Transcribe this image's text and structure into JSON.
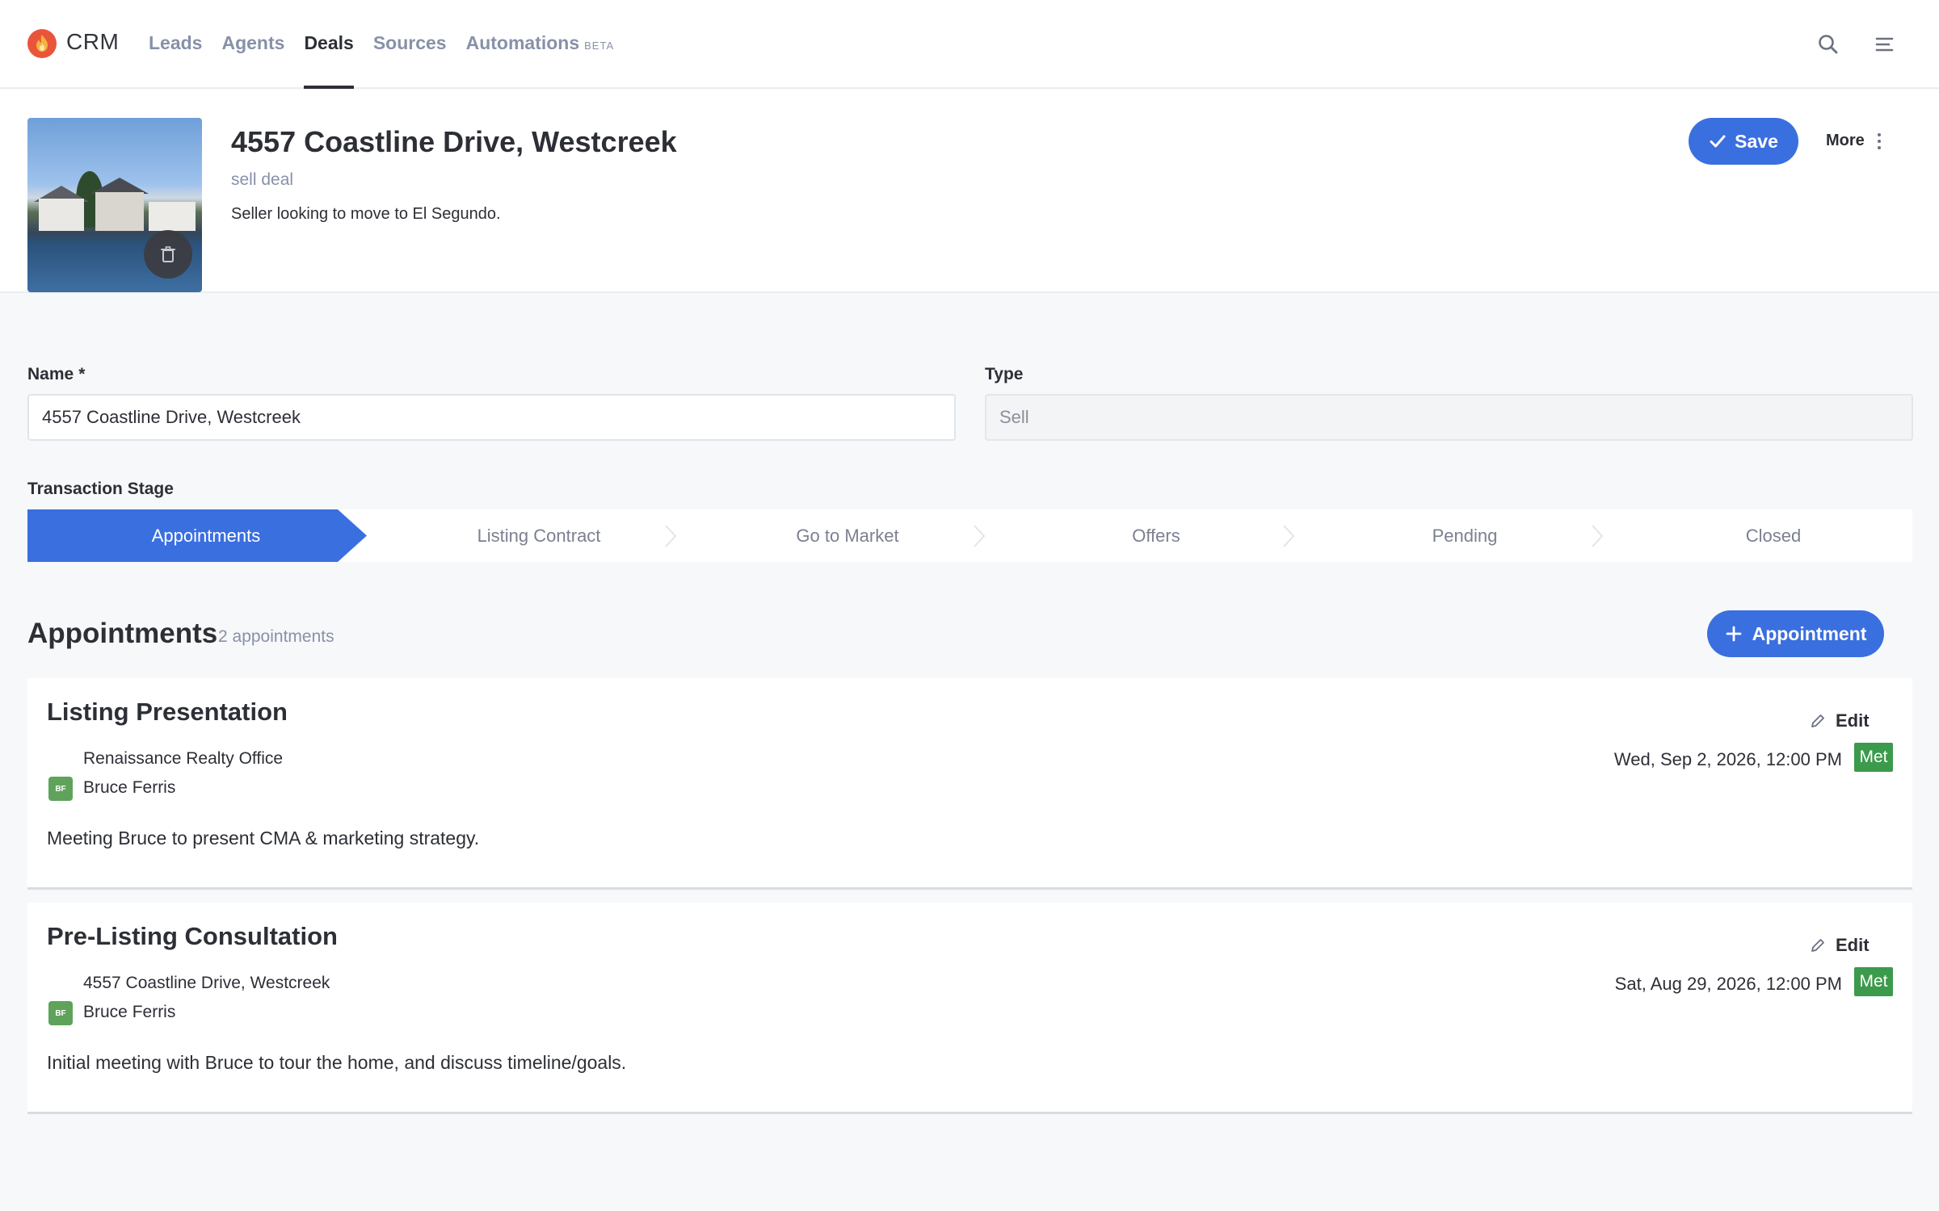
{
  "app": {
    "brand": "CRM",
    "nav": [
      {
        "label": "Leads"
      },
      {
        "label": "Agents"
      },
      {
        "label": "Deals"
      },
      {
        "label": "Sources"
      },
      {
        "label": "Automations"
      }
    ],
    "active_nav": "Deals",
    "beta_label": "BETA"
  },
  "deal": {
    "title": "4557 Coastline Drive, Westcreek",
    "subtitle": "sell deal",
    "description": "Seller looking to move to El Segundo.",
    "save_label": "Save",
    "more_label": "More"
  },
  "form": {
    "name_label": "Name",
    "name_required": "*",
    "name_value": "4557 Coastline Drive, Westcreek",
    "type_label": "Type",
    "type_value": "Sell",
    "stage_label": "Transaction Stage"
  },
  "stages": [
    "Appointments",
    "Listing Contract",
    "Go to Market",
    "Offers",
    "Pending",
    "Closed"
  ],
  "active_stage": "Appointments",
  "appointments": {
    "heading": "Appointments",
    "count_label": "2 appointments",
    "add_label": "Appointment",
    "edit_label": "Edit",
    "items": [
      {
        "title": "Listing Presentation",
        "location": "Renaissance Realty Office",
        "person_initials": "BF",
        "person": "Bruce Ferris",
        "datetime": "Wed, Sep 2, 2026, 12:00 PM",
        "status": "Met",
        "note": "Meeting Bruce to present CMA & marketing strategy."
      },
      {
        "title": "Pre-Listing Consultation",
        "location": "4557 Coastline Drive, Westcreek",
        "person_initials": "BF",
        "person": "Bruce Ferris",
        "datetime": "Sat, Aug 29, 2026, 12:00 PM",
        "status": "Met",
        "note": "Initial meeting with Bruce to tour the home, and discuss timeline/goals."
      }
    ]
  },
  "colors": {
    "accent": "#3a6fe0",
    "status_met": "#3c9a4c",
    "avatar": "#5fa35a",
    "logo": "#e8553b"
  },
  "icons": [
    "flame-logo-icon",
    "search-icon",
    "menu-icon",
    "trash-icon",
    "check-icon",
    "kebab-icon",
    "plus-icon",
    "pencil-icon"
  ]
}
